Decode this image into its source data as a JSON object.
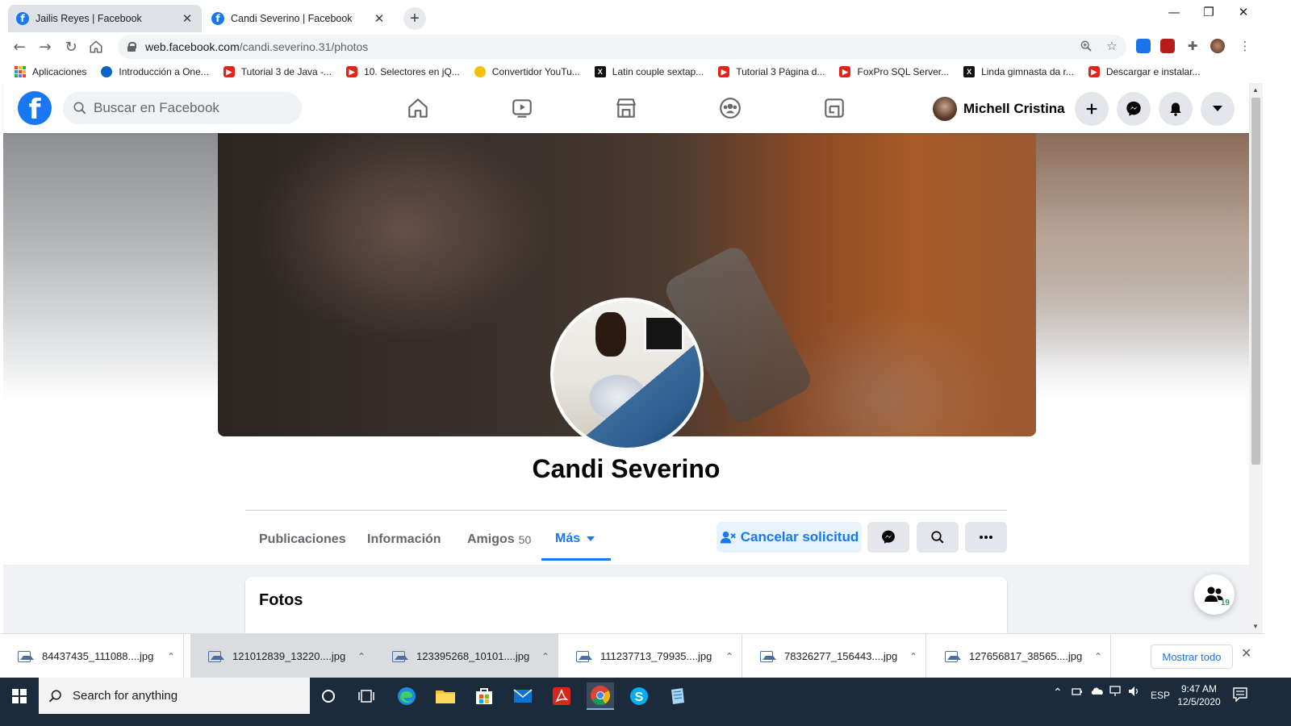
{
  "browser": {
    "tabs": [
      {
        "title": "Jailis Reyes | Facebook",
        "active": false
      },
      {
        "title": "Candi Severino | Facebook",
        "active": true
      }
    ],
    "url_host": "web.facebook.com",
    "url_path": "/candi.severino.31/photos",
    "bookmarks": [
      {
        "label": "Aplicaciones",
        "icon": "apps-grid-icon"
      },
      {
        "label": "Introducción a One...",
        "icon": "cloud-icon"
      },
      {
        "label": "Tutorial 3 de Java -...",
        "icon": "youtube-icon"
      },
      {
        "label": "10. Selectores en jQ...",
        "icon": "youtube-icon"
      },
      {
        "label": "Convertidor YouTu...",
        "icon": "smile-icon"
      },
      {
        "label": "Latin couple sextap...",
        "icon": "x-icon"
      },
      {
        "label": "Tutorial 3 Página d...",
        "icon": "youtube-icon"
      },
      {
        "label": "FoxPro SQL Server...",
        "icon": "youtube-icon"
      },
      {
        "label": "Linda gimnasta da r...",
        "icon": "x-icon"
      },
      {
        "label": "Descargar e instalar...",
        "icon": "youtube-icon"
      }
    ]
  },
  "facebook": {
    "search_placeholder": "Buscar en Facebook",
    "user_name": "Michell Cristina",
    "profile": {
      "name": "Candi Severino",
      "tabs": {
        "posts": "Publicaciones",
        "info": "Información",
        "friends": "Amigos",
        "friends_count": "50",
        "more": "Más"
      },
      "cancel_request_label": "Cancelar solicitud",
      "photos_heading": "Fotos"
    },
    "friends_online_count": "19",
    "colors": {
      "brand": "#1877f2",
      "online": "#31a24c"
    }
  },
  "downloads": {
    "items": [
      "84437435_111088....jpg",
      "121012839_13220....jpg",
      "123395268_10101....jpg",
      "111237713_79935....jpg",
      "78326277_156443....jpg",
      "127656817_38565....jpg"
    ],
    "show_all": "Mostrar todo"
  },
  "taskbar": {
    "search_placeholder": "Search for anything",
    "language": "ESP",
    "time": "9:47 AM",
    "date": "12/5/2020"
  }
}
